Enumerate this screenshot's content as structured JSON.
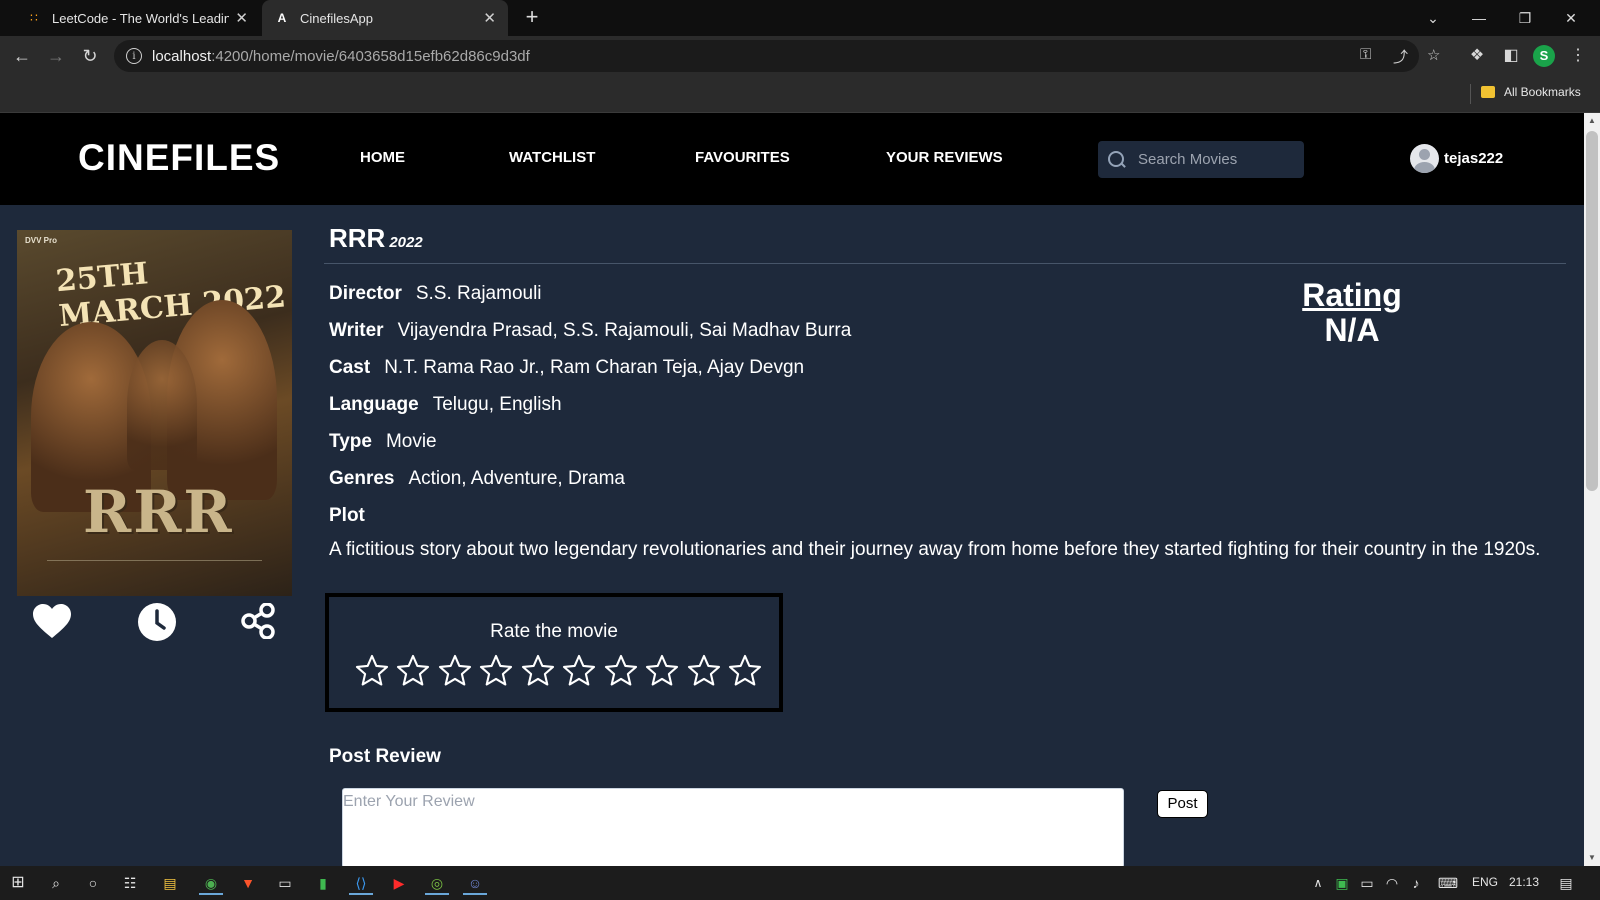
{
  "browser": {
    "tabs": [
      {
        "title": "LeetCode - The World's Leading",
        "icon": "leetcode-icon"
      },
      {
        "title": "CinefilesApp",
        "icon": "angular-icon"
      }
    ],
    "url_host": "localhost",
    "url_path": ":4200/home/movie/6403658d15efb62d86c9d3df",
    "profile_initial": "S",
    "bookmarks_label": "All Bookmarks"
  },
  "app": {
    "logo": "CINEFILES",
    "nav": [
      "HOME",
      "WATCHLIST",
      "FAVOURITES",
      "YOUR REVIEWS"
    ],
    "search_placeholder": "Search Movies",
    "username": "tejas222"
  },
  "movie": {
    "title": "RRR",
    "year": "2022",
    "poster": {
      "top_text": "DVV Pro",
      "date_text": "25TH MARCH 2022",
      "title_text": "RRR"
    },
    "details": [
      {
        "label": "Director",
        "value": "S.S. Rajamouli"
      },
      {
        "label": "Writer",
        "value": "Vijayendra Prasad, S.S. Rajamouli, Sai Madhav Burra"
      },
      {
        "label": "Cast",
        "value": "N.T. Rama Rao Jr., Ram Charan Teja, Ajay Devgn"
      },
      {
        "label": "Language",
        "value": "Telugu, English"
      },
      {
        "label": "Type",
        "value": "Movie"
      },
      {
        "label": "Genres",
        "value": "Action, Adventure, Drama"
      }
    ],
    "plot_label": "Plot",
    "plot": "A fictitious story about two legendary revolutionaries and their journey away from home before they started fighting for their country in the 1920s.",
    "rating_label": "Rating",
    "rating_value": "N/A"
  },
  "rate": {
    "title": "Rate the movie",
    "max_stars": 10,
    "selected": 0
  },
  "review": {
    "title": "Post Review",
    "placeholder": "Enter Your Review",
    "post_label": "Post"
  },
  "taskbar": {
    "lang": "ENG",
    "time": "21:13"
  }
}
